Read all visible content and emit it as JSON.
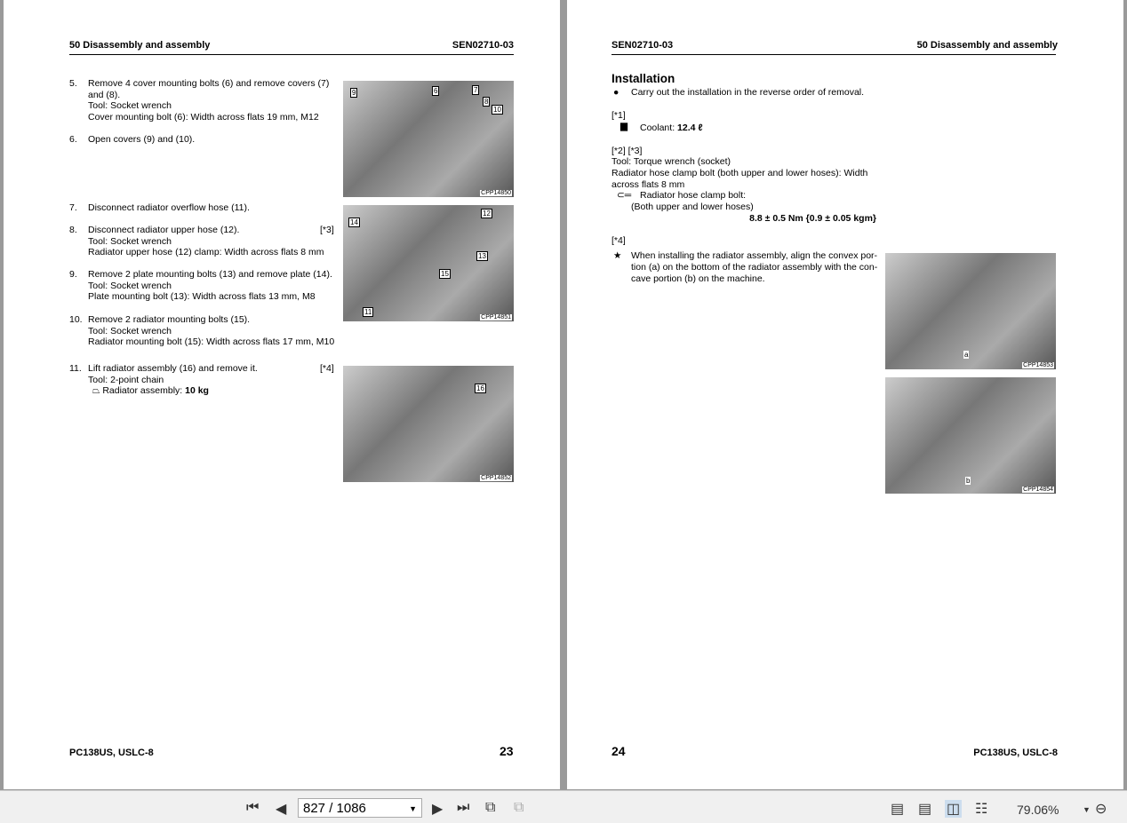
{
  "left_page": {
    "header_left": "50 Disassembly and assembly",
    "header_right": "SEN02710-03",
    "steps": [
      {
        "num": "5.",
        "lines": [
          "Remove 4 cover mounting bolts (6) and remove covers (7)",
          "and (8).",
          "Tool: Socket wrench",
          "Cover mounting bolt (6): Width across flats 19 mm, M12"
        ]
      },
      {
        "num": "6.",
        "lines": [
          "Open covers (9) and (10)."
        ]
      },
      {
        "num": "7.",
        "lines": [
          "Disconnect radiator overflow hose (11)."
        ]
      },
      {
        "num": "8.",
        "lines": [
          "Disconnect radiator upper hose (12).",
          "Tool: Socket wrench",
          "Radiator upper hose (12) clamp: Width across flats 8 mm"
        ],
        "ref": "[*3]"
      },
      {
        "num": "9.",
        "lines": [
          "Remove 2 plate mounting bolts (13) and remove plate (14).",
          "Tool: Socket wrench",
          "Plate mounting bolt (13): Width across flats 13 mm, M8"
        ]
      },
      {
        "num": "10.",
        "lines": [
          "Remove 2 radiator mounting bolts (15).",
          "Tool: Socket wrench",
          "Radiator mounting bolt (15): Width across flats 17 mm, M10"
        ]
      },
      {
        "num": "11.",
        "lines": [
          "Lift radiator assembly (16) and remove it.",
          "Tool: 2-point chain"
        ],
        "ref": "[*4]",
        "weight_label": "Radiator assembly: ",
        "weight_value": "10 kg"
      }
    ],
    "photos": [
      {
        "code": "CPP14850",
        "callouts": [
          "9",
          "6",
          "7",
          "8",
          "10"
        ]
      },
      {
        "code": "CPP14851",
        "callouts": [
          "14",
          "12",
          "13",
          "15",
          "11"
        ]
      },
      {
        "code": "CPP14852",
        "callouts": [
          "16"
        ]
      }
    ],
    "footer_model": "PC138US, USLC-8",
    "page_number": "23"
  },
  "right_page": {
    "header_left": "SEN02710-03",
    "header_right": "50 Disassembly and assembly",
    "section_title": "Installation",
    "bullet": "Carry out the installation in the reverse order of removal.",
    "ref1": "[*1]",
    "coolant_label": "Coolant: ",
    "coolant_value": "12.4 ℓ",
    "ref23": "[*2]  [*3]",
    "tool_lines": [
      "Tool: Torque wrench (socket)",
      "Radiator hose clamp bolt (both upper and lower hoses): Width",
      "across flats 8 mm"
    ],
    "torque_label": "Radiator hose clamp bolt:",
    "torque_sub": "(Both upper and lower hoses)",
    "torque_value": "8.8 ± 0.5 Nm {0.9 ± 0.05 kgm}",
    "ref4": "[*4]",
    "note_lines": [
      "When installing the radiator assembly, align the convex por-",
      "tion (a) on the bottom of the radiator assembly with the con-",
      "cave portion (b) on the machine."
    ],
    "photos": [
      {
        "code": "CPP14853",
        "callouts": [
          "a"
        ]
      },
      {
        "code": "CPP14854",
        "callouts": [
          "b"
        ]
      }
    ],
    "page_number": "24",
    "footer_model": "PC138US, USLC-8"
  },
  "toolbar": {
    "page_field": "827 / 1086",
    "zoom": "79.06%"
  }
}
